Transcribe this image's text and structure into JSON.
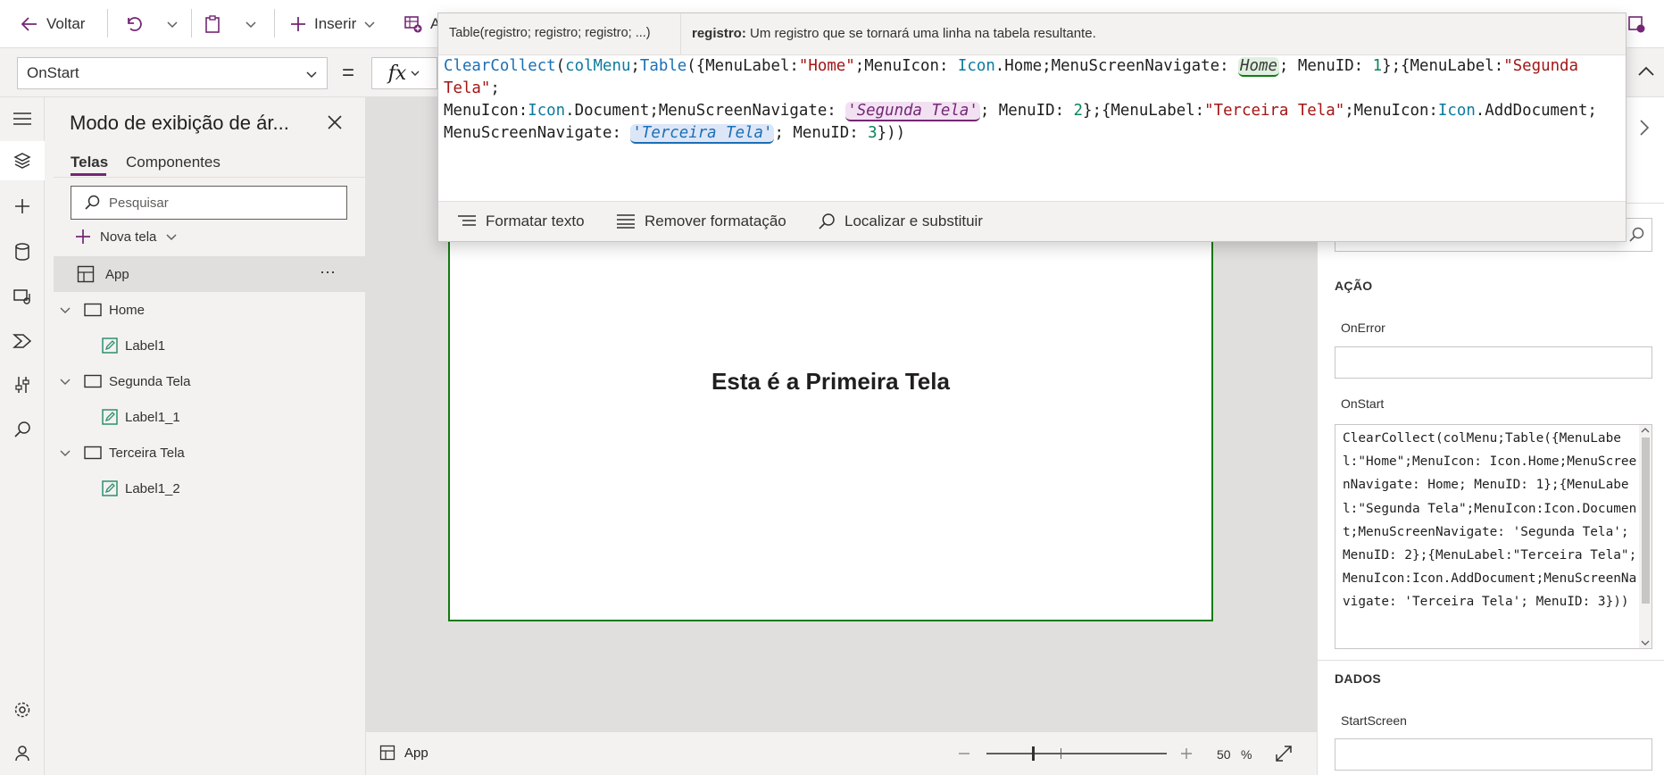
{
  "toolbar": {
    "back_label": "Voltar",
    "insert_label": "Inserir",
    "add_data_fragment": "A"
  },
  "formula_bar": {
    "property": "OnStart",
    "equals": "=",
    "fx": "fx"
  },
  "popup": {
    "signature": "Table(registro; registro; registro; ...)",
    "param_name": "registro:",
    "param_desc": "Um registro que se tornará uma linha na tabela resultante.",
    "code": {
      "t1": "ClearCollect",
      "t2": "(",
      "t3": "colMenu",
      "t4": ";",
      "t5": "Table",
      "t6": "({MenuLabel:",
      "t7": "\"Home\"",
      "t8": ";MenuIcon: ",
      "t9": "Icon",
      "t10": ".Home;MenuScreenNavigate: ",
      "t11": "Home",
      "t12": "; MenuID: ",
      "t13": "1",
      "t14": "};{MenuLabel:",
      "t15": "\"Segunda Tela\"",
      "t16": ";",
      "t17": "MenuIcon:",
      "t18": "Icon",
      "t19": ".Document;MenuScreenNavigate: ",
      "t20": "'Segunda Tela'",
      "t21": "; MenuID: ",
      "t22": "2",
      "t23": "};{MenuLabel:",
      "t24": "\"Terceira Tela\"",
      "t25": ";MenuIcon:",
      "t26": "Icon",
      "t27": ".AddDocument;",
      "t28": "MenuScreenNavigate: ",
      "t29": "'Terceira Tela'",
      "t30": "; MenuID: ",
      "t31": "3",
      "t32": "}))"
    },
    "tools": {
      "format": "Formatar texto",
      "remove_format": "Remover formatação",
      "find_replace": "Localizar e substituir"
    }
  },
  "tree": {
    "title": "Modo de exibição de ár...",
    "tabs": [
      "Telas",
      "Componentes"
    ],
    "search_placeholder": "Pesquisar",
    "new_screen": "Nova tela",
    "app_label": "App",
    "nodes": [
      "Home",
      "Label1",
      "Segunda Tela",
      "Label1_1",
      "Terceira Tela",
      "Label1_2"
    ]
  },
  "canvas": {
    "screen_text": "Esta é a Primeira Tela"
  },
  "status": {
    "selected": "App",
    "zoom_value": "50",
    "zoom_unit": "%",
    "zoom_level": 0.5
  },
  "props": {
    "section_action": "AÇÃO",
    "on_error": "OnError",
    "on_start": "OnStart",
    "on_start_value": "ClearCollect(colMenu;Table({MenuLabel:\"Home\";MenuIcon: Icon.Home;MenuScreenNavigate: Home; MenuID: 1};{MenuLabel:\"Segunda Tela\";MenuIcon:Icon.Document;MenuScreenNavigate: 'Segunda Tela'; MenuID: 2};{MenuLabel:\"Terceira Tela\";MenuIcon:Icon.AddDocument;MenuScreenNavigate: 'Terceira Tela'; MenuID: 3}))",
    "section_data": "DADOS",
    "start_screen": "StartScreen"
  },
  "colors": {
    "accent": "#742774",
    "screen_border": "#107c10",
    "token_home_bg": "#dff0e0",
    "token_segunda_bg": "#f2e1f2",
    "token_terceira_bg": "#dde6f7"
  },
  "icons": [
    "back-arrow-icon",
    "undo-icon",
    "chevron-down-icon",
    "paste-icon",
    "plus-icon",
    "add-data-icon",
    "fx-icon",
    "hamburger-icon",
    "layers-icon",
    "database-icon",
    "media-icon",
    "power-automate-icon",
    "tools-icon",
    "search-icon",
    "gear-icon",
    "virtual-agent-icon",
    "close-icon",
    "screen-icon",
    "label-icon",
    "more-icon",
    "expand-icon",
    "chevron-up-icon",
    "chevron-right-icon"
  ]
}
